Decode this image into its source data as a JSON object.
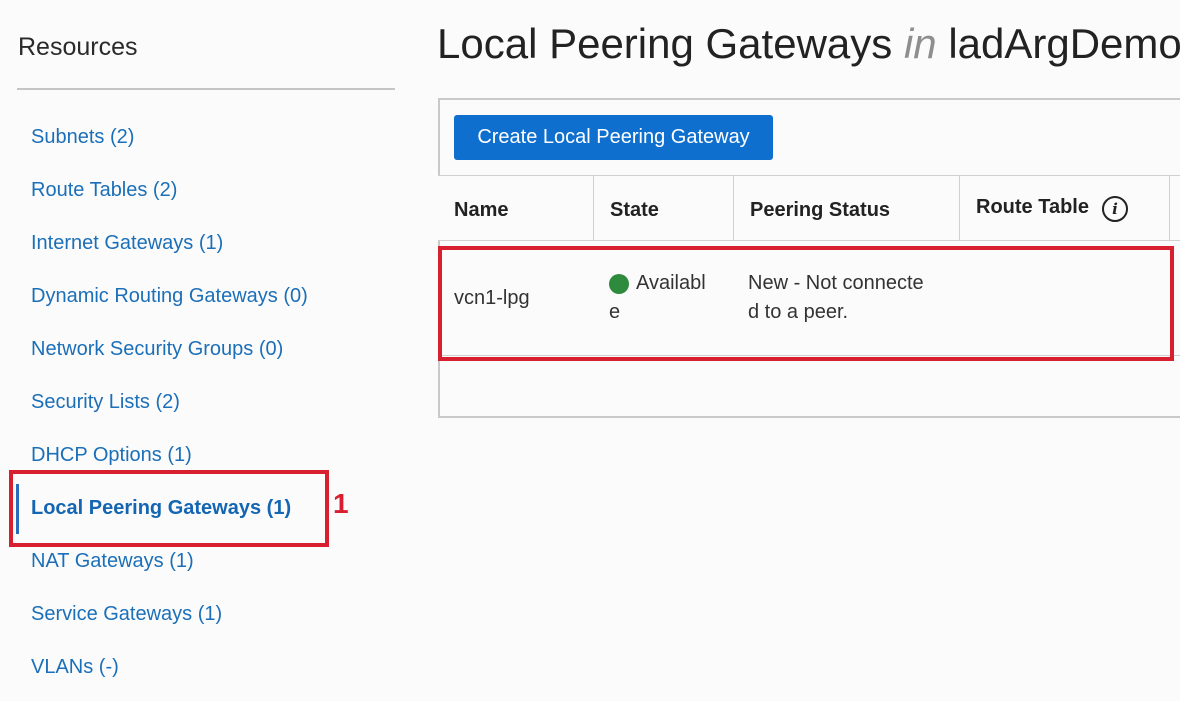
{
  "sidebar": {
    "title": "Resources",
    "items": [
      {
        "label": "Subnets (2)"
      },
      {
        "label": "Route Tables (2)"
      },
      {
        "label": "Internet Gateways (1)"
      },
      {
        "label": "Dynamic Routing Gateways (0)"
      },
      {
        "label": "Network Security Groups (0)"
      },
      {
        "label": "Security Lists (2)"
      },
      {
        "label": "DHCP Options (1)"
      },
      {
        "label": "Local Peering Gateways (1)"
      },
      {
        "label": "NAT Gateways (1)"
      },
      {
        "label": "Service Gateways (1)"
      },
      {
        "label": "VLANs (-)"
      }
    ]
  },
  "annotation": {
    "number": "1",
    "color": "#d71f2f"
  },
  "main": {
    "title_main": "Local Peering Gateways",
    "title_in": "in",
    "title_compartment": "ladArgDemo",
    "create_button": "Create Local Peering Gateway",
    "table": {
      "columns": [
        "Name",
        "State",
        "Peering Status",
        "Route Table"
      ],
      "info_icon": "info-icon",
      "rows": [
        {
          "name": "vcn1-lpg",
          "state_line1": "Availabl",
          "state_line2": "e",
          "state_color": "#2e8b3e",
          "peering_line1": "New - Not connecte",
          "peering_line2": "d to a peer.",
          "route_table": ""
        }
      ]
    }
  },
  "colors": {
    "link": "#1b6fb8",
    "primary_button": "#0f6fcf",
    "highlight": "#d71f2f"
  }
}
